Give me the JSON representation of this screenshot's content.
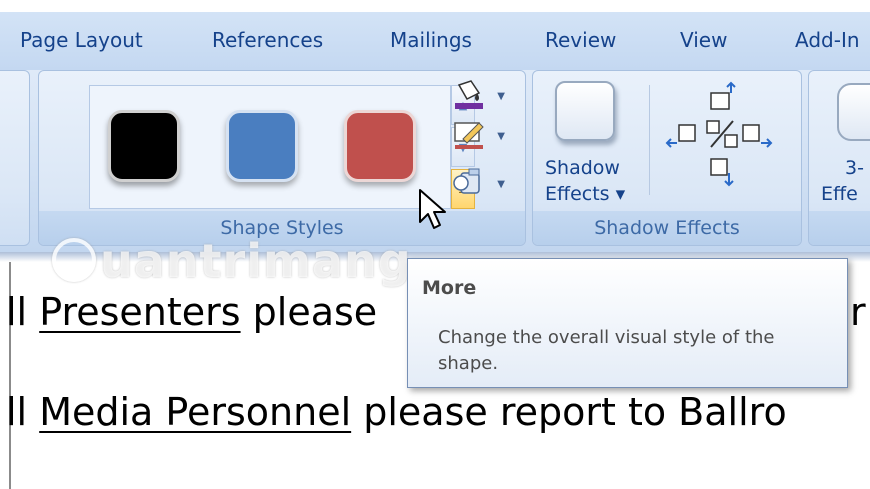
{
  "tabs": [
    "Page Layout",
    "References",
    "Mailings",
    "Review",
    "View",
    "Add-In"
  ],
  "shape_styles": {
    "group_label": "Shape Styles",
    "swatches": [
      {
        "name": "black",
        "color": "#000000"
      },
      {
        "name": "blue",
        "color": "#4a7ec0"
      },
      {
        "name": "red",
        "color": "#c0504d"
      }
    ]
  },
  "shadow_effects": {
    "button_label_line1": "Shadow",
    "button_label_line2": "Effects ▾",
    "group_label": "Shadow Effects"
  },
  "three_d": {
    "label_line1": "3-",
    "label_line2": "Effe"
  },
  "document": {
    "line1_prefix": "ll ",
    "line1_underlined": "Presenters",
    "line1_suffix": " please",
    "line1_tail": "r",
    "line2_prefix": "ll ",
    "line2_underlined": "Media Personnel",
    "line2_suffix": " please report to Ballro"
  },
  "watermark": "uantrimang",
  "tooltip": {
    "title": "More",
    "description": "Change the overall visual style of the shape."
  },
  "colors": {
    "accent": "#15428b",
    "ribbon": "#dbe7f6",
    "hot_button": "#ffd66e"
  },
  "icons": [
    "fill-color-icon",
    "outline-pen-icon",
    "shape-effects-icon",
    "shadow-icon",
    "nudge-up-icon",
    "nudge-left-icon",
    "toggle-shadow-icon",
    "nudge-right-icon",
    "nudge-down-icon",
    "dialog-launcher-icon",
    "mouse-pointer-icon"
  ]
}
